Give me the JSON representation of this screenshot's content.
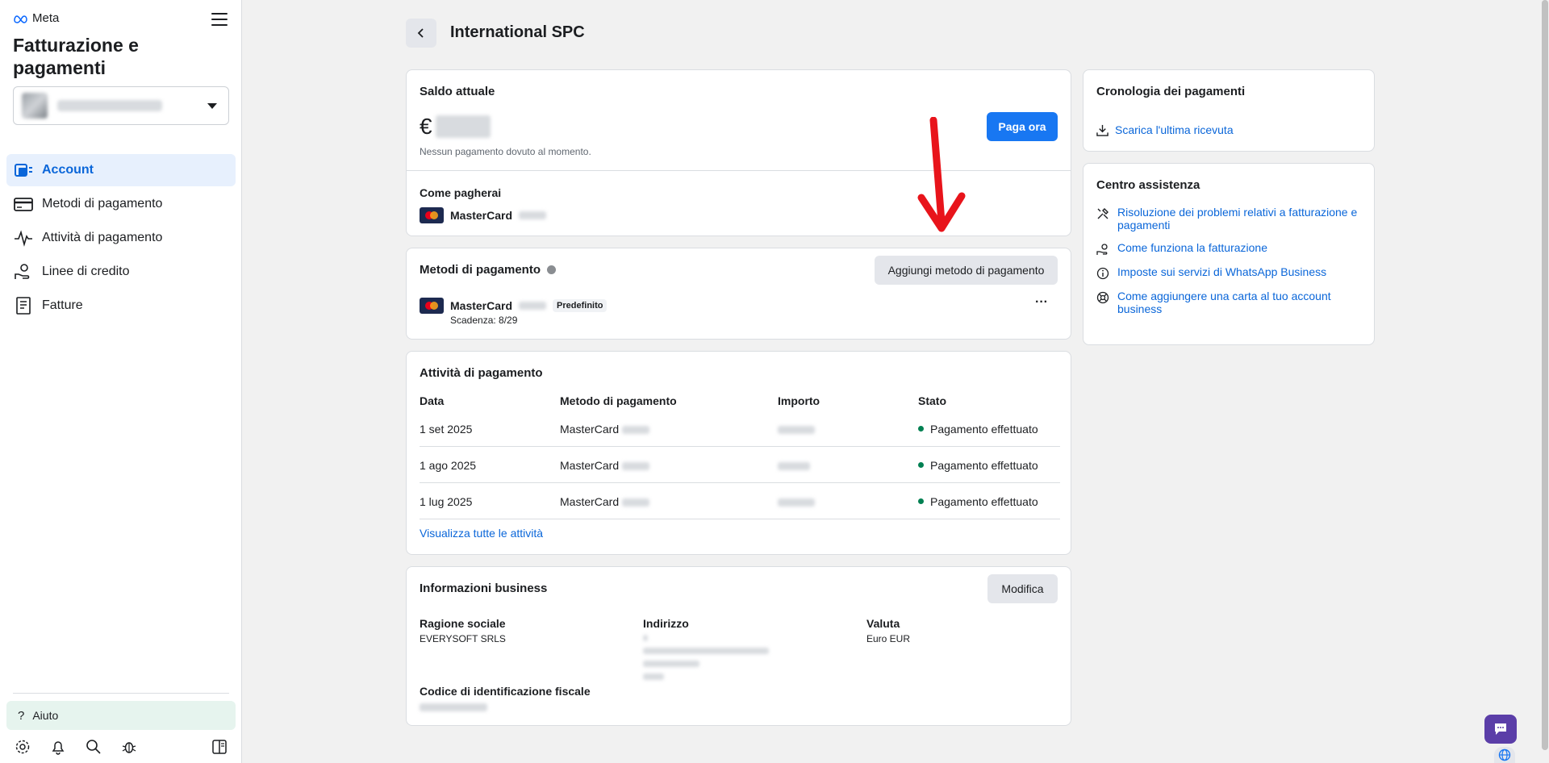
{
  "sidebar": {
    "logo_text": "Meta",
    "title": "Fatturazione e pagamenti",
    "account_name": "",
    "nav": [
      {
        "label": "Account",
        "icon": "account-icon",
        "active": true
      },
      {
        "label": "Metodi di pagamento",
        "icon": "credit-card-icon"
      },
      {
        "label": "Attività di pagamento",
        "icon": "activity-pulse-icon"
      },
      {
        "label": "Linee di credito",
        "icon": "credit-line-icon"
      },
      {
        "label": "Fatture",
        "icon": "invoice-icon"
      }
    ],
    "help_label": "Aiuto",
    "tools": [
      "settings-icon",
      "bell-icon",
      "search-icon",
      "bug-icon",
      "panel-toggle-icon"
    ]
  },
  "header": {
    "title": "International SPC"
  },
  "balance": {
    "title": "Saldo attuale",
    "currency": "€",
    "note": "Nessun pagamento dovuto al momento.",
    "pay_button": "Paga ora",
    "pay_method_title": "Come pagherai",
    "pay_method_card": "MasterCard"
  },
  "payment_methods": {
    "title": "Metodi di pagamento",
    "add_button": "Aggiungi metodo di pagamento",
    "card_name": "MasterCard",
    "default_badge": "Predefinito",
    "expiry": "Scadenza: 8/29",
    "more": "···"
  },
  "activity": {
    "title": "Attività di pagamento",
    "columns": [
      "Data",
      "Metodo di pagamento",
      "Importo",
      "Stato"
    ],
    "rows": [
      {
        "date": "1 set 2025",
        "method": "MasterCard",
        "status": "Pagamento effettuato"
      },
      {
        "date": "1 ago 2025",
        "method": "MasterCard",
        "status": "Pagamento effettuato"
      },
      {
        "date": "1 lug 2025",
        "method": "MasterCard",
        "status": "Pagamento effettuato"
      }
    ],
    "view_all": "Visualizza tutte le attività"
  },
  "business": {
    "title": "Informazioni business",
    "edit_button": "Modifica",
    "company_label": "Ragione sociale",
    "company_value": "EVERYSOFT SRLS",
    "address_label": "Indirizzo",
    "currency_label": "Valuta",
    "currency_value": "Euro EUR",
    "tax_label": "Codice di identificazione fiscale"
  },
  "history": {
    "title": "Cronologia dei pagamenti",
    "download_link": "Scarica l'ultima ricevuta"
  },
  "help_center": {
    "title": "Centro assistenza",
    "links": [
      {
        "label": "Risoluzione dei problemi relativi a fatturazione e pagamenti",
        "icon": "tools-icon"
      },
      {
        "label": "Come funziona la fatturazione",
        "icon": "hand-coin-icon"
      },
      {
        "label": "Imposte sui servizi di WhatsApp Business",
        "icon": "info-icon"
      },
      {
        "label": "Come aggiungere una carta al tuo account business",
        "icon": "lifebuoy-icon"
      }
    ]
  },
  "colors": {
    "accent": "#1877f2",
    "active_nav_bg": "#e7f0fd",
    "status_success": "#008052",
    "annotation_arrow": "#e8141b",
    "chat_button": "#5b3ea8"
  }
}
